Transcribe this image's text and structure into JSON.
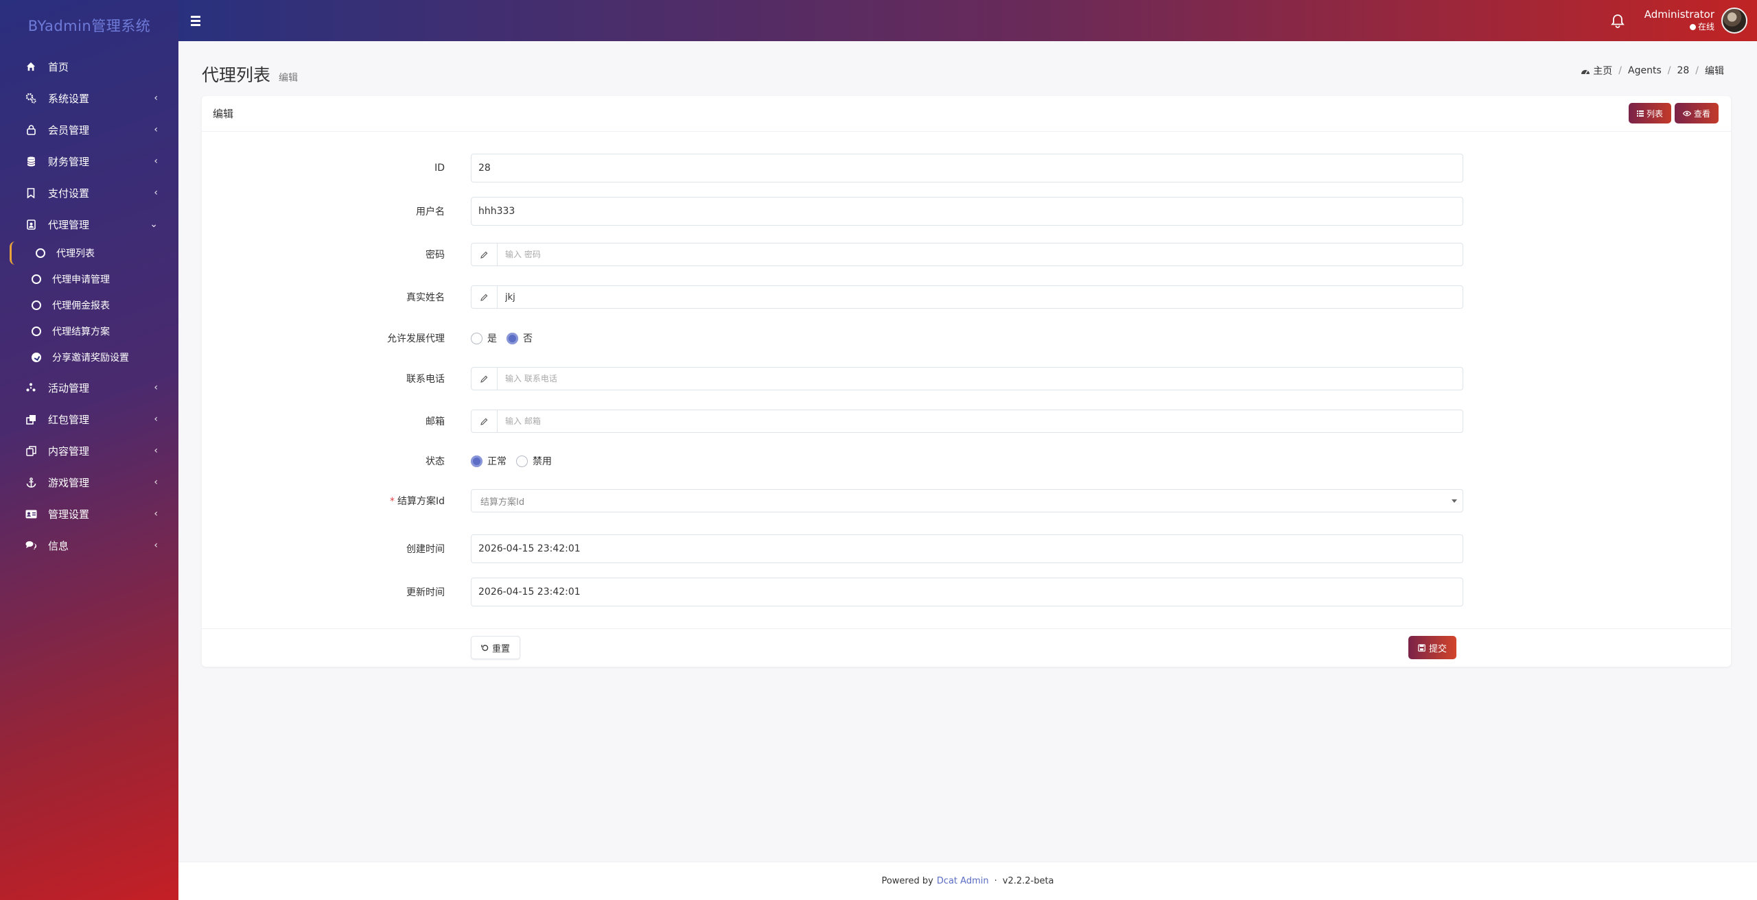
{
  "brand": "BYadmin管理系统",
  "sidebar": {
    "items": [
      {
        "label": "首页",
        "icon": "home-icon"
      },
      {
        "label": "系统设置",
        "icon": "gears-icon"
      },
      {
        "label": "会员管理",
        "icon": "lock-icon"
      },
      {
        "label": "财务管理",
        "icon": "database-icon"
      },
      {
        "label": "支付设置",
        "icon": "bookmark-icon"
      },
      {
        "label": "代理管理",
        "icon": "id-badge-icon"
      },
      {
        "label": "活动管理",
        "icon": "asterisk-icon"
      },
      {
        "label": "红包管理",
        "icon": "clone-icon"
      },
      {
        "label": "内容管理",
        "icon": "copy-icon"
      },
      {
        "label": "游戏管理",
        "icon": "anchor-icon"
      },
      {
        "label": "管理设置",
        "icon": "id-card-icon"
      },
      {
        "label": "信息",
        "icon": "comments-icon"
      }
    ],
    "agent_submenu": [
      {
        "label": "代理列表"
      },
      {
        "label": "代理申请管理"
      },
      {
        "label": "代理佣金报表"
      },
      {
        "label": "代理结算方案"
      },
      {
        "label": "分享邀请奖励设置"
      }
    ]
  },
  "topbar": {
    "user_name": "Administrator",
    "user_status": "在线"
  },
  "page": {
    "title": "代理列表",
    "subtitle": "编辑"
  },
  "breadcrumb": {
    "home": "主页",
    "items": [
      "Agents",
      "28",
      "编辑"
    ]
  },
  "card": {
    "title": "编辑",
    "list_button": "列表",
    "view_button": "查看"
  },
  "form": {
    "id": {
      "label": "ID",
      "value": "28"
    },
    "username": {
      "label": "用户名",
      "value": "hhh333"
    },
    "password": {
      "label": "密码",
      "placeholder": "输入 密码",
      "value": ""
    },
    "realname": {
      "label": "真实姓名",
      "value": "jkj"
    },
    "allow_agent": {
      "label": "允许发展代理",
      "options": [
        "是",
        "否"
      ],
      "selected": "否"
    },
    "phone": {
      "label": "联系电话",
      "placeholder": "输入 联系电话",
      "value": ""
    },
    "email": {
      "label": "邮箱",
      "placeholder": "输入 邮箱",
      "value": ""
    },
    "status": {
      "label": "状态",
      "options": [
        "正常",
        "禁用"
      ],
      "selected": "正常"
    },
    "settlement": {
      "label": "结算方案Id",
      "placeholder": "结算方案Id",
      "required": true
    },
    "created_at": {
      "label": "创建时间",
      "value": "2026-04-15 23:42:01"
    },
    "updated_at": {
      "label": "更新时间",
      "value": "2026-04-15 23:42:01"
    },
    "reset_button": "重置",
    "submit_button": "提交"
  },
  "footer": {
    "powered_by": "Powered by",
    "link": "Dcat Admin",
    "separator": "·",
    "version": "v2.2.2-beta"
  },
  "colors": {
    "accent": "#5b6dc4",
    "brand_gradient_start": "#29317e",
    "brand_gradient_end": "#c02424",
    "active_indicator": "#e8a33a"
  }
}
